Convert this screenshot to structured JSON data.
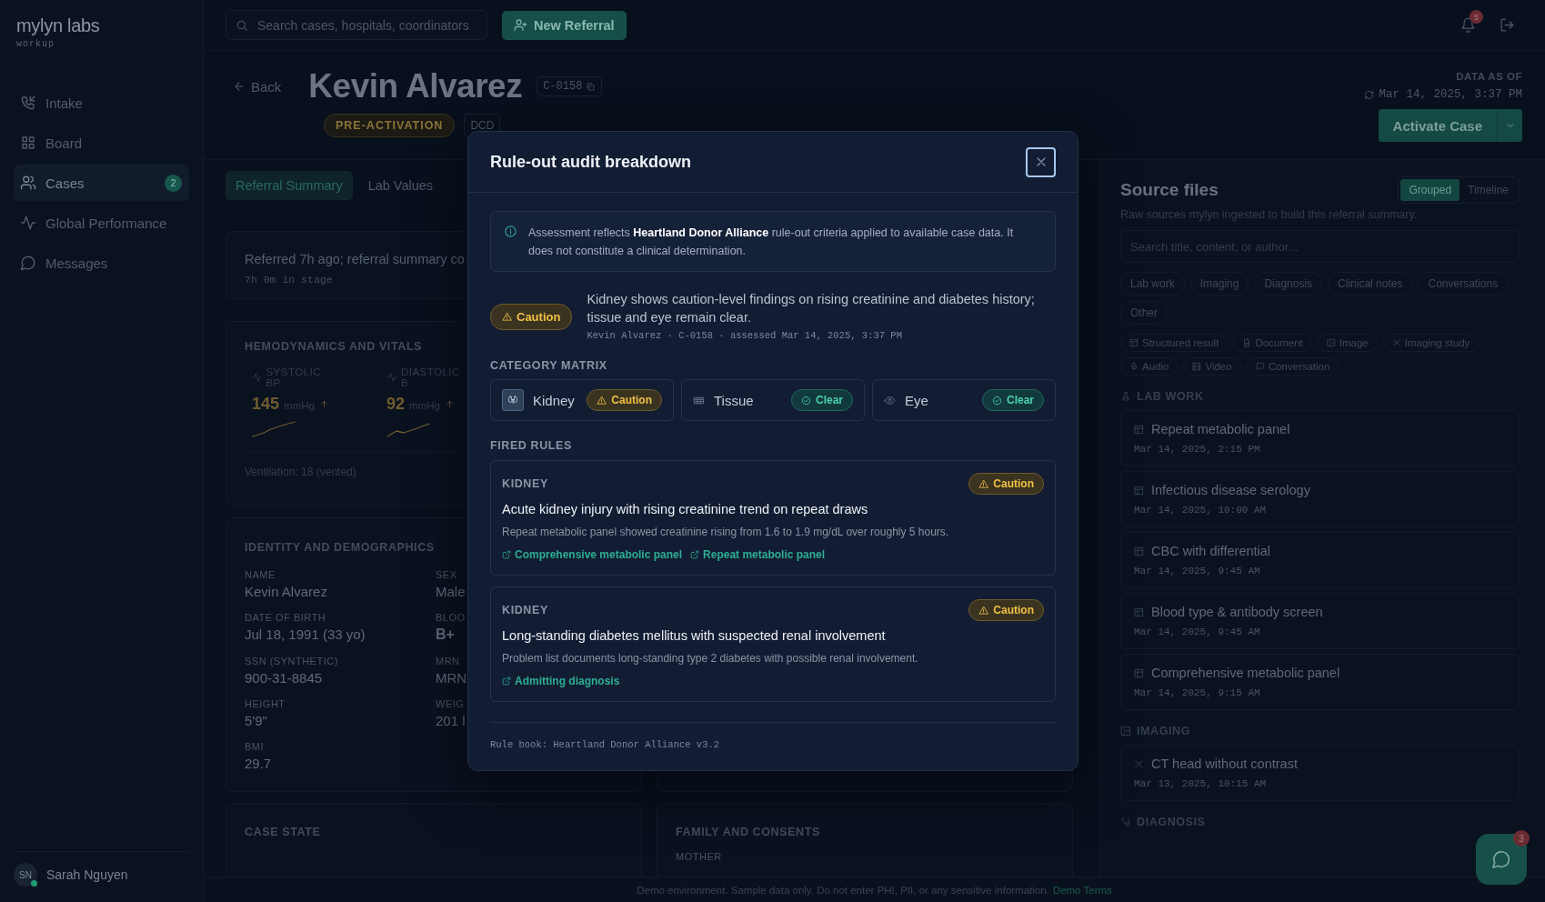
{
  "sidebar": {
    "logo": "mylyn labs",
    "subtitle": "workup",
    "items": [
      {
        "label": "Intake",
        "selected": false
      },
      {
        "label": "Board",
        "selected": false
      },
      {
        "label": "Cases",
        "selected": true,
        "badge": "2"
      },
      {
        "label": "Global Performance",
        "selected": false
      },
      {
        "label": "Messages",
        "selected": false
      }
    ],
    "user": {
      "initials": "SN",
      "name": "Sarah Nguyen",
      "online": true
    }
  },
  "topbar": {
    "search_placeholder": "Search cases, hospitals, coordinators",
    "new_button": "New Referral",
    "notifications": "5"
  },
  "case": {
    "back": "Back",
    "name": "Kevin Alvarez",
    "id": "C-0158",
    "stage": "PRE-ACTIVATION",
    "type": "DCD",
    "data_as_of_label": "DATA AS OF",
    "data_as_of": "Mar 14, 2025, 3:37 PM",
    "activate": "Activate Case"
  },
  "tabs": [
    {
      "label": "Referral Summary",
      "selected": true
    },
    {
      "label": "Lab Values",
      "selected": false
    }
  ],
  "summary": {
    "text": "Referred 7h ago; referral summary co",
    "stage_time": "7h 0m in stage"
  },
  "vitals": {
    "title": "HEMODYNAMICS AND VITALS",
    "items": [
      {
        "label": "SYSTOLIC BP",
        "value": "145",
        "unit": "mmHg"
      },
      {
        "label": "DIASTOLIC B",
        "value": "92",
        "unit": "mmHg"
      }
    ],
    "note": "Ventilation: 18 (vented)"
  },
  "identity": {
    "title": "IDENTITY AND DEMOGRAPHICS",
    "fields": [
      {
        "label": "NAME",
        "value": "Kevin Alvarez",
        "emphasis": false
      },
      {
        "label": "SEX",
        "value": "Male",
        "emphasis": false
      },
      {
        "label": "DATE OF BIRTH",
        "value": "Jul 18, 1991 (33 yo)",
        "emphasis": false
      },
      {
        "label": "BLOO",
        "value": "B+",
        "emphasis": true
      },
      {
        "label": "SSN (SYNTHETIC)",
        "value": "900-31-8845",
        "emphasis": false
      },
      {
        "label": "MRN",
        "value": "MRN",
        "emphasis": false
      },
      {
        "label": "HEIGHT",
        "value": "5'9\"",
        "emphasis": false
      },
      {
        "label": "WEIG",
        "value": "201 l",
        "emphasis": false
      },
      {
        "label": "BMI",
        "value": "29.7",
        "emphasis": false
      }
    ]
  },
  "case_state": {
    "title": "CASE STATE"
  },
  "family": {
    "title": "FAMILY AND CONSENTS",
    "first_label": "MOTHER"
  },
  "source_files": {
    "title": "Source files",
    "subtitle": "Raw sources mylyn ingested to build this referral summary.",
    "views": [
      {
        "label": "Grouped",
        "selected": true
      },
      {
        "label": "Timeline",
        "selected": false
      }
    ],
    "search_placeholder": "Search title, content, or author...",
    "categories": [
      "Lab work",
      "Imaging",
      "Diagnosis",
      "Clinical notes",
      "Conversations",
      "Other"
    ],
    "types": [
      "Structured result",
      "Document",
      "Image",
      "Imaging study",
      "Audio",
      "Video",
      "Conversation"
    ],
    "groups": [
      {
        "title": "LAB WORK",
        "files": [
          {
            "title": "Repeat metabolic panel",
            "date": "Mar 14, 2025, 2:15 PM"
          },
          {
            "title": "Infectious disease serology",
            "date": "Mar 14, 2025, 10:00 AM"
          },
          {
            "title": "CBC with differential",
            "date": "Mar 14, 2025, 9:45 AM"
          },
          {
            "title": "Blood type & antibody screen",
            "date": "Mar 14, 2025, 9:45 AM"
          },
          {
            "title": "Comprehensive metabolic panel",
            "date": "Mar 14, 2025, 9:15 AM"
          }
        ]
      },
      {
        "title": "IMAGING",
        "files": [
          {
            "title": "CT head without contrast",
            "date": "Mar 13, 2025, 10:15 AM"
          }
        ]
      },
      {
        "title": "DIAGNOSIS"
      }
    ]
  },
  "modal": {
    "title": "Rule-out audit breakdown",
    "notice": "Assessment reflects **Heartland Donor Alliance** rule-out criteria applied to available case data. It does not constitute a clinical determination.",
    "verdict": {
      "kind": "caution",
      "label": "Caution"
    },
    "verdict_text": "Kidney shows caution-level findings on rising creatinine and diabetes history; tissue and eye remain clear.",
    "meta": "Kevin Alvarez · C-0158 · assessed Mar 14, 2025, 3:37 PM",
    "matrix_title": "CATEGORY MATRIX",
    "matrix": [
      {
        "name": "Kidney",
        "kind": "caution",
        "label": "Caution"
      },
      {
        "name": "Tissue",
        "kind": "clear",
        "label": "Clear"
      },
      {
        "name": "Eye",
        "kind": "clear",
        "label": "Clear"
      }
    ],
    "rules_title": "FIRED RULES",
    "rules": [
      {
        "category": "KIDNEY",
        "kind": "caution",
        "label": "Caution",
        "title": "Acute kidney injury with rising creatinine trend on repeat draws",
        "description": "Repeat metabolic panel showed creatinine rising from 1.6 to 1.9 mg/dL over roughly 5 hours.",
        "evidence": [
          "Comprehensive metabolic panel",
          "Repeat metabolic panel"
        ]
      },
      {
        "category": "KIDNEY",
        "kind": "caution",
        "label": "Caution",
        "title": "Long-standing diabetes mellitus with suspected renal involvement",
        "description": "Problem list documents long-standing type 2 diabetes with possible renal involvement.",
        "evidence": [
          "Admitting diagnosis"
        ]
      }
    ],
    "rule_book": "Rule book: Heartland Donor Alliance v3.2"
  },
  "footer": {
    "text": "Demo environment. Sample data only. Do not enter PHI, PII, or any sensitive information.",
    "link": "Demo Terms"
  },
  "chat": {
    "badge": "3"
  }
}
